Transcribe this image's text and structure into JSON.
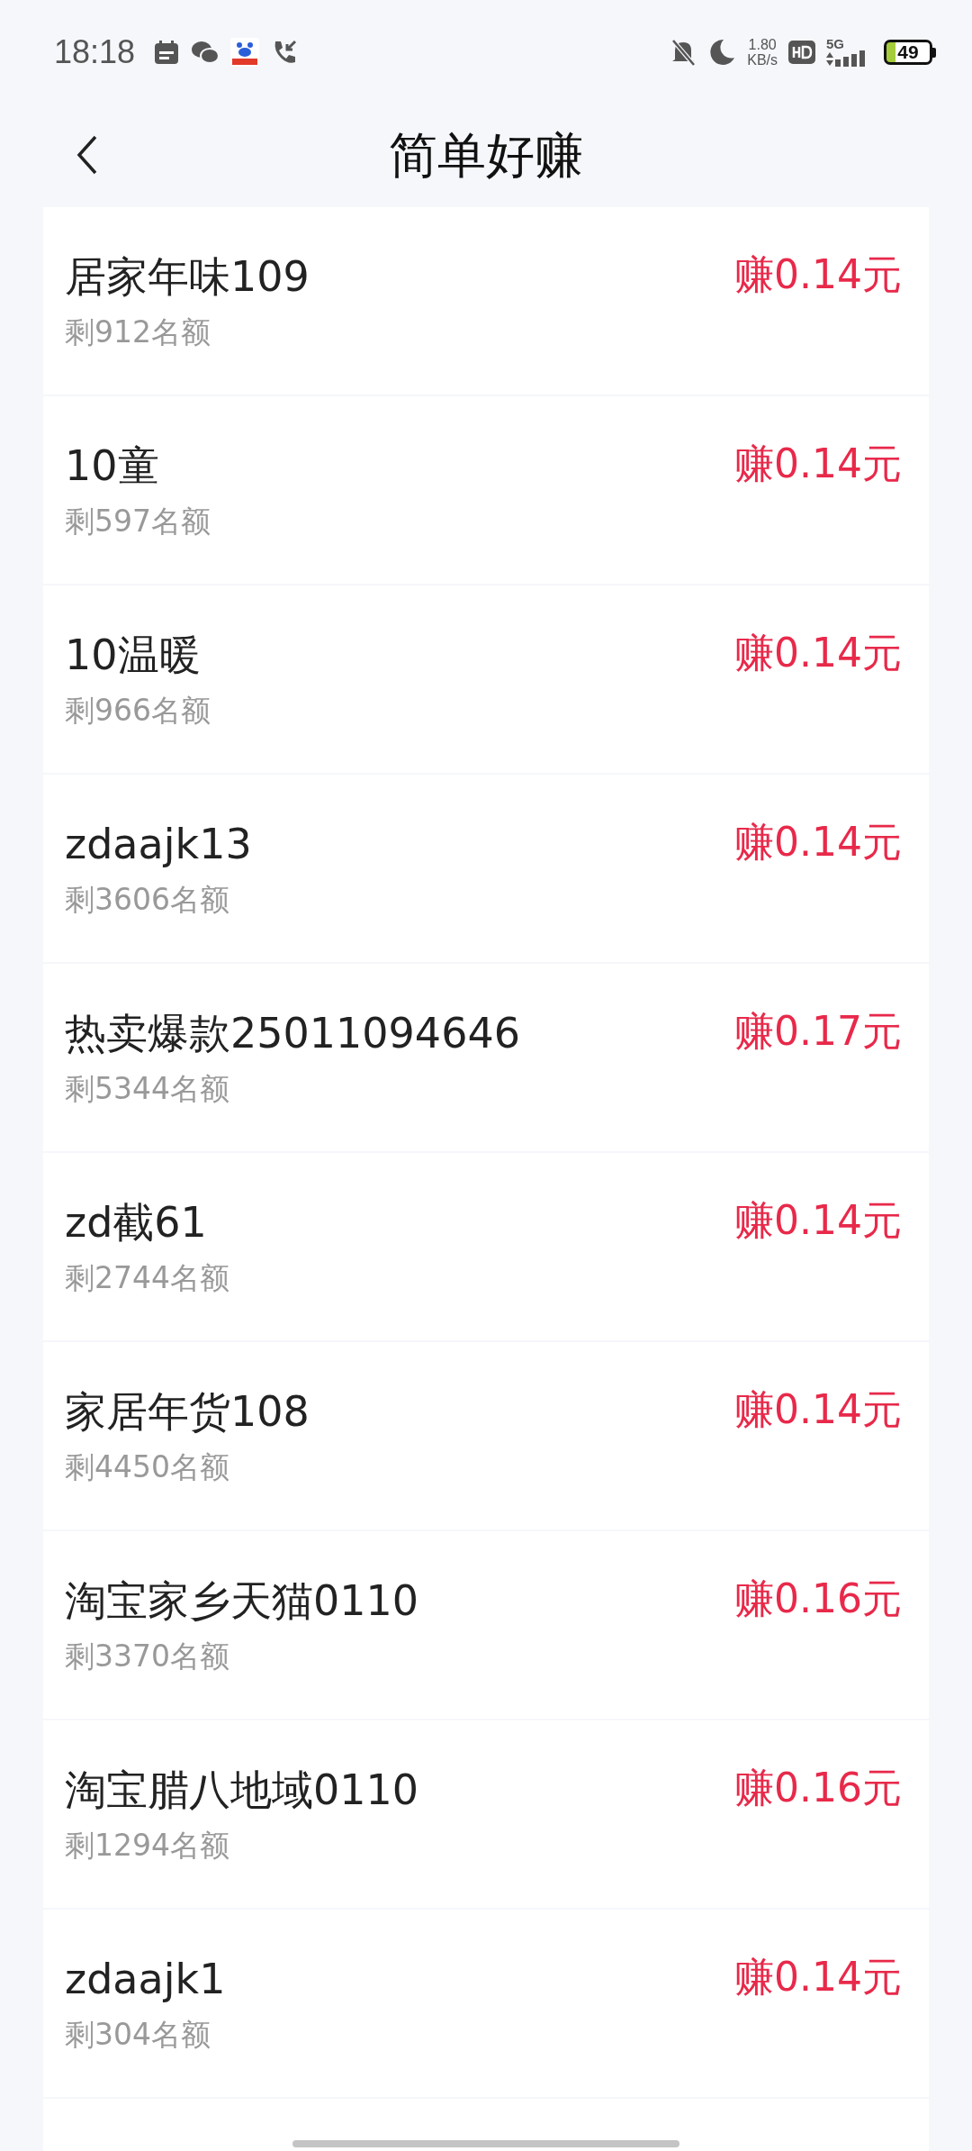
{
  "status_bar": {
    "time": "18:18",
    "net_speed": "1.80",
    "net_unit": "KB/s",
    "network": "5G",
    "battery": "49"
  },
  "header": {
    "title": "简单好赚"
  },
  "tasks": [
    {
      "name": "居家年味109",
      "remaining": "剩912名额",
      "reward": "赚0.14元"
    },
    {
      "name": "10童",
      "remaining": "剩597名额",
      "reward": "赚0.14元"
    },
    {
      "name": "10温暖",
      "remaining": "剩966名额",
      "reward": "赚0.14元"
    },
    {
      "name": "zdaajk13",
      "remaining": "剩3606名额",
      "reward": "赚0.14元"
    },
    {
      "name": "热卖爆款25011094646",
      "remaining": "剩5344名额",
      "reward": "赚0.17元"
    },
    {
      "name": "zd截61",
      "remaining": "剩2744名额",
      "reward": "赚0.14元"
    },
    {
      "name": "家居年货108",
      "remaining": "剩4450名额",
      "reward": "赚0.14元"
    },
    {
      "name": "淘宝家乡天猫0110",
      "remaining": "剩3370名额",
      "reward": "赚0.16元"
    },
    {
      "name": "淘宝腊八地域0110",
      "remaining": "剩1294名额",
      "reward": "赚0.16元"
    },
    {
      "name": "zdaajk1",
      "remaining": "剩304名额",
      "reward": "赚0.14元"
    }
  ]
}
